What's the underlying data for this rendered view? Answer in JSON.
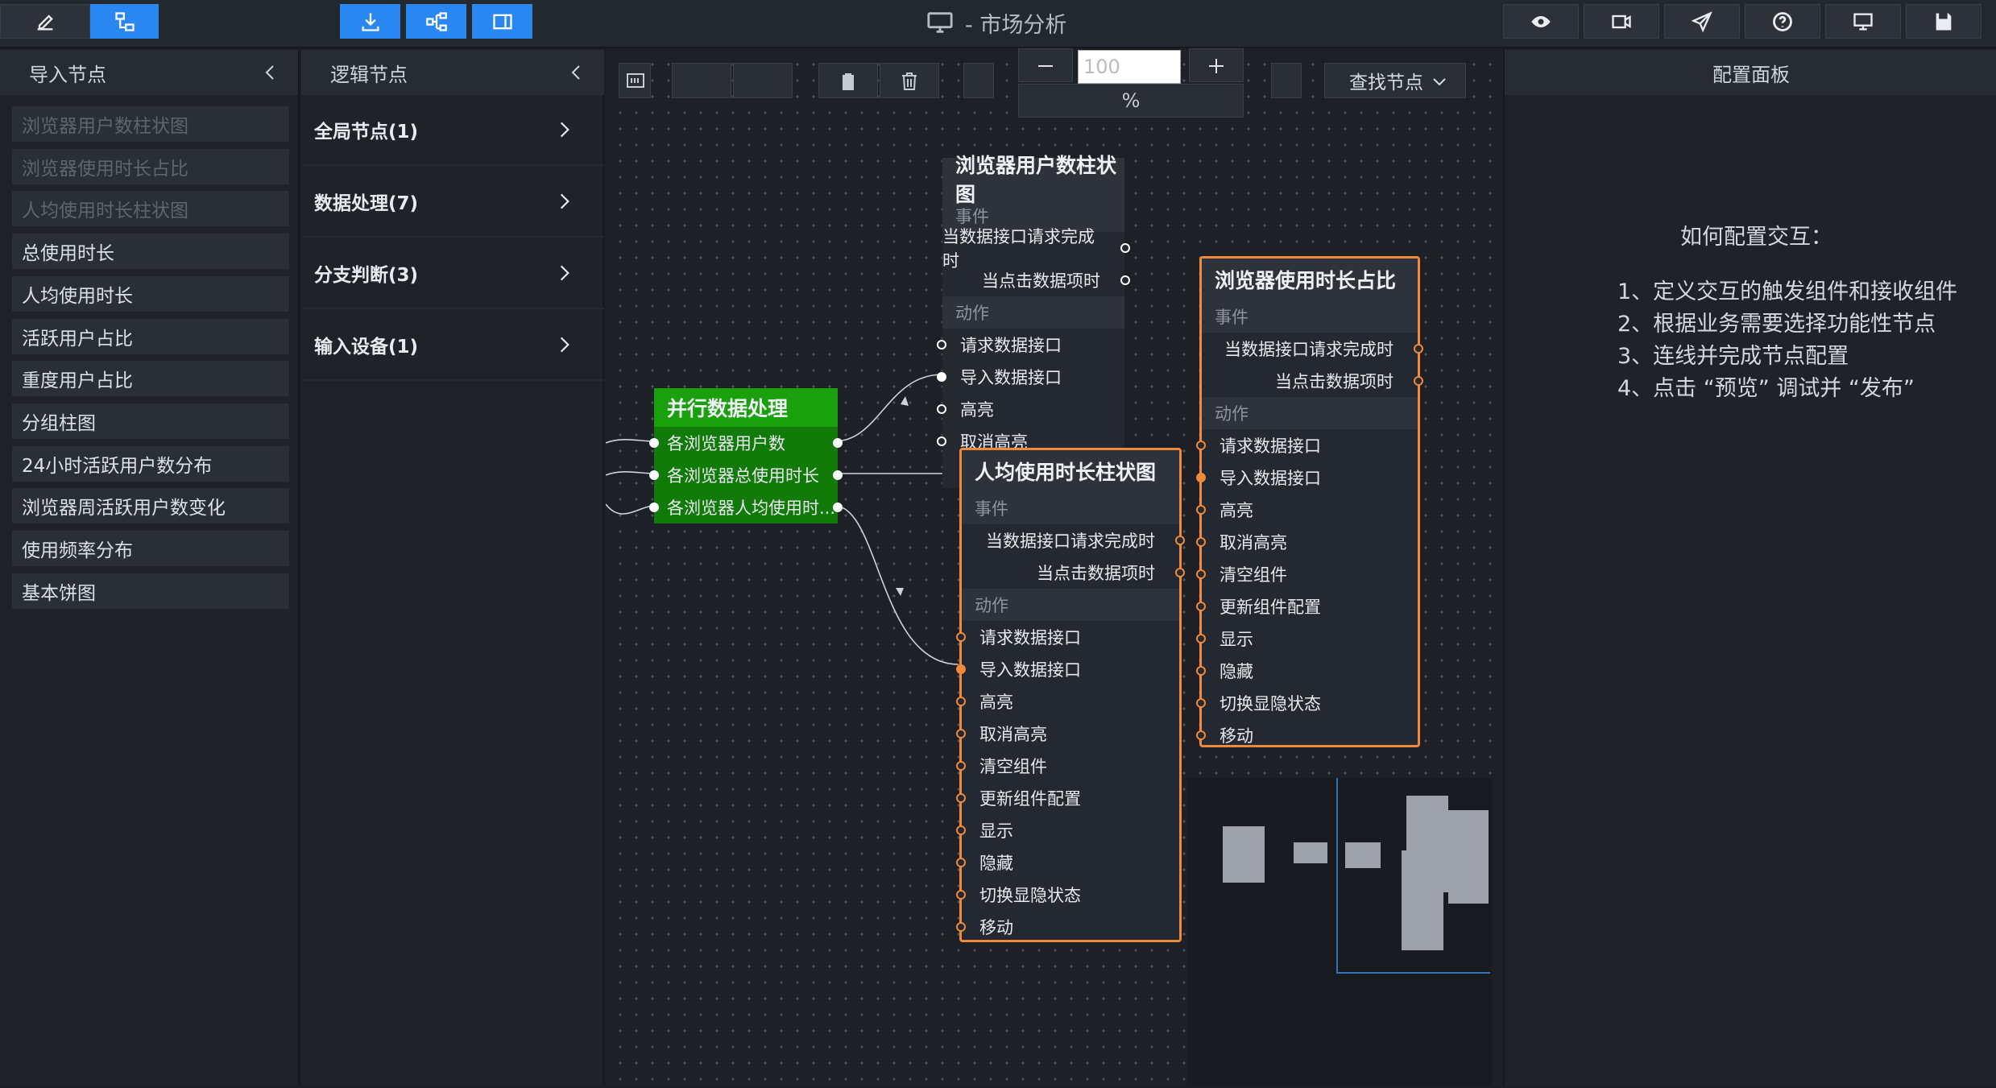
{
  "header": {
    "title": "- 市场分析",
    "zoom_value": "100",
    "zoom_unit": "%",
    "find_node_label": "查找节点"
  },
  "import_panel": {
    "title": "导入节点",
    "items": [
      {
        "label": "浏览器用户数柱状图",
        "dim": true
      },
      {
        "label": "浏览器使用时长占比",
        "dim": true
      },
      {
        "label": "人均使用时长柱状图",
        "dim": true
      },
      {
        "label": "总使用时长",
        "dim": false
      },
      {
        "label": "人均使用时长",
        "dim": false
      },
      {
        "label": "活跃用户占比",
        "dim": false
      },
      {
        "label": "重度用户占比",
        "dim": false
      },
      {
        "label": "分组柱图",
        "dim": false
      },
      {
        "label": "24小时活跃用户数分布",
        "dim": false
      },
      {
        "label": "浏览器周活跃用户数变化",
        "dim": false
      },
      {
        "label": "使用频率分布",
        "dim": false
      },
      {
        "label": "基本饼图",
        "dim": false
      }
    ]
  },
  "logic_panel": {
    "title": "逻辑节点",
    "categories": [
      "全局节点(1)",
      "数据处理(7)",
      "分支判断(3)",
      "输入设备(1)"
    ]
  },
  "config_panel": {
    "title": "配置面板",
    "heading": "如何配置交互：",
    "steps": [
      "1、定义交互的触发组件和接收组件",
      "2、根据业务需要选择功能性节点",
      "3、连线并完成节点配置",
      "4、点击 “预览” 调试并 “发布”"
    ]
  },
  "nodes": {
    "parallel": {
      "title": "并行数据处理",
      "rows": [
        "各浏览器用户数",
        "各浏览器总使用时长",
        "各浏览器人均使用时..."
      ]
    },
    "users_bar": {
      "title": "浏览器用户数柱状图",
      "event_label": "事件",
      "events": [
        "当数据接口请求完成时",
        "当点击数据项时"
      ],
      "action_label": "动作",
      "actions": [
        "请求数据接口",
        "导入数据接口",
        "高亮",
        "取消高亮"
      ]
    },
    "usage_ratio": {
      "title": "浏览器使用时长占比",
      "event_label": "事件",
      "events": [
        "当数据接口请求完成时",
        "当点击数据项时"
      ],
      "action_label": "动作",
      "actions": [
        "请求数据接口",
        "导入数据接口",
        "高亮",
        "取消高亮",
        "清空组件",
        "更新组件配置",
        "显示",
        "隐藏",
        "切换显隐状态",
        "移动"
      ]
    },
    "avg_bar": {
      "title": "人均使用时长柱状图",
      "event_label": "事件",
      "events": [
        "当数据接口请求完成时",
        "当点击数据项时"
      ],
      "action_label": "动作",
      "actions": [
        "请求数据接口",
        "导入数据接口",
        "高亮",
        "取消高亮",
        "清空组件",
        "更新组件配置",
        "显示",
        "隐藏",
        "切换显隐状态",
        "移动"
      ]
    }
  },
  "colors": {
    "accent_blue": "#2a86f0",
    "node_green": "#1a9e0b",
    "highlight_orange": "#f0893a"
  }
}
